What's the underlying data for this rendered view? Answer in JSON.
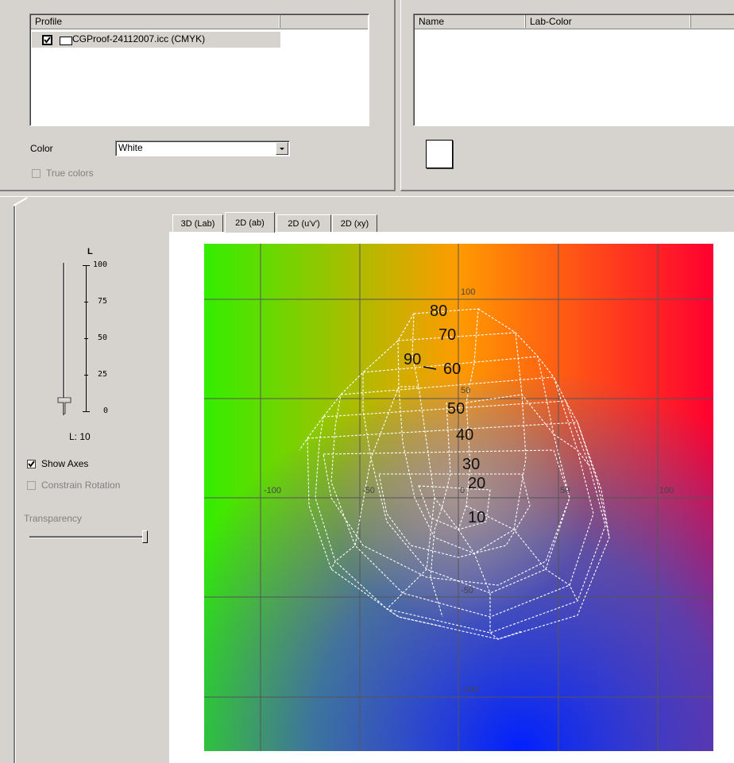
{
  "profile_panel": {
    "column_header": "Profile",
    "items": [
      {
        "label": "CGProof-24112007.icc (CMYK)",
        "checked": true
      }
    ],
    "color_label": "Color",
    "color_value": "White",
    "true_colors_label": "True colors"
  },
  "colors_panel": {
    "columns": [
      "Name",
      "Lab-Color",
      ""
    ],
    "swatch_color": "#ffffff"
  },
  "tabs": [
    "3D (Lab)",
    "2D (ab)",
    "2D (u'v')",
    "2D (xy)"
  ],
  "active_tab": "2D (ab)",
  "controls": {
    "l_title": "L",
    "l_ticks": [
      "100",
      "75",
      "50",
      "25",
      "0"
    ],
    "l_value_label": "L: 10",
    "show_axes_label": "Show Axes",
    "constrain_rotation_label": "Constrain Rotation",
    "transparency_label": "Transparency",
    "transparency_level": 1.0,
    "l_slider_level": 0.1
  },
  "plot": {
    "axis_labels_a": [
      "-100",
      "-50",
      "0",
      "50",
      "100"
    ],
    "axis_labels_b": [
      "100",
      "50",
      "-50",
      "-100"
    ],
    "contour_labels": [
      "80",
      "70",
      "90",
      "60",
      "50",
      "40",
      "30",
      "20",
      "10"
    ],
    "gridline_color": "#555555"
  }
}
